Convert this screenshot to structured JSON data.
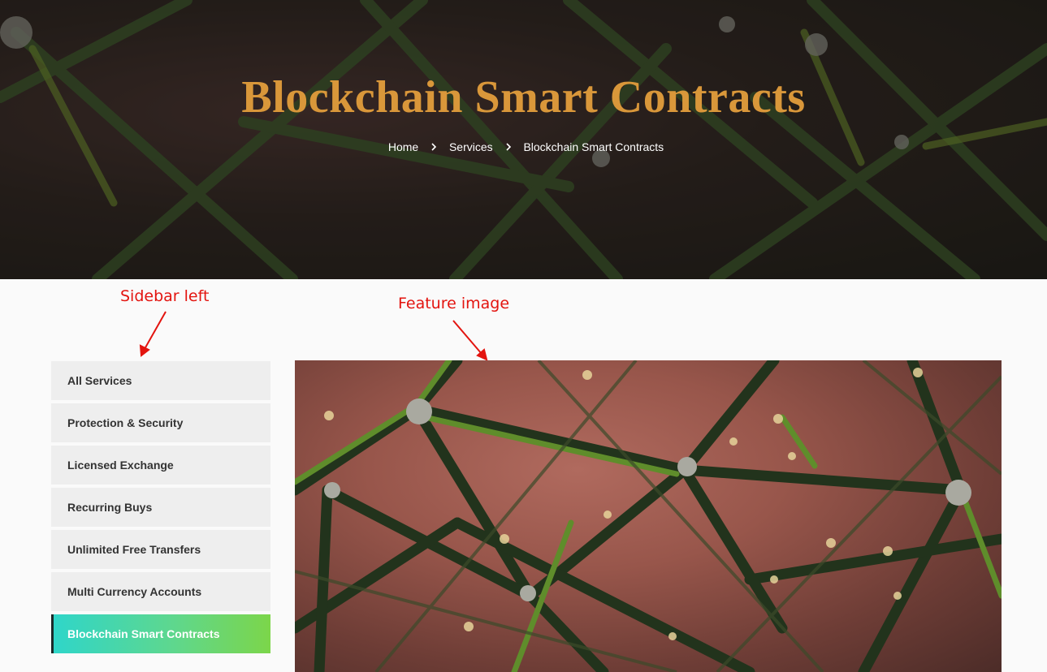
{
  "hero": {
    "title": "Blockchain Smart Contracts",
    "breadcrumb": [
      {
        "label": "Home"
      },
      {
        "label": "Services"
      },
      {
        "label": "Blockchain Smart Contracts"
      }
    ],
    "separator_icon": "chevron-right-icon"
  },
  "annotations": {
    "sidebar_label": "Sidebar left",
    "feature_label": "Feature image",
    "color": "#e3140f"
  },
  "sidebar": {
    "items": [
      {
        "label": "All Services",
        "active": false
      },
      {
        "label": "Protection & Security",
        "active": false
      },
      {
        "label": "Licensed Exchange",
        "active": false
      },
      {
        "label": "Recurring Buys",
        "active": false
      },
      {
        "label": "Unlimited Free Transfers",
        "active": false
      },
      {
        "label": "Multi Currency Accounts",
        "active": false
      },
      {
        "label": "Blockchain Smart Contracts",
        "active": true
      }
    ]
  },
  "colors": {
    "title": "#d9973a",
    "active_gradient_start": "#2fd6c9",
    "active_gradient_end": "#7cd64a",
    "sidebar_item_bg": "#eeeeee"
  }
}
